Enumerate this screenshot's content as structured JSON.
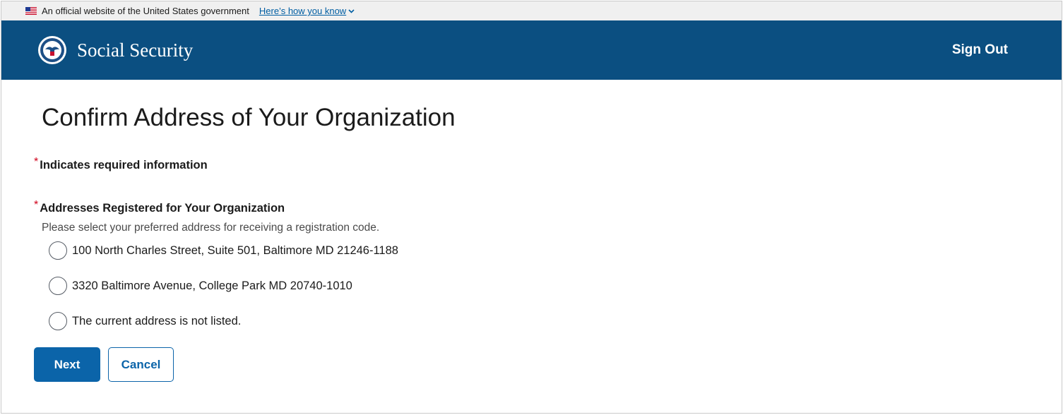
{
  "gov_banner": {
    "text": "An official website of the United States government",
    "link_label": "Here’s how you know"
  },
  "header": {
    "brand": "Social Security",
    "sign_out": "Sign Out"
  },
  "page": {
    "title": "Confirm Address of Your Organization",
    "required_marker": "*",
    "required_note": "Indicates required information"
  },
  "address_field": {
    "legend": "Addresses Registered for Your Organization",
    "hint": "Please select your preferred address for receiving a registration code.",
    "options": [
      {
        "label": "100 North Charles Street, Suite 501, Baltimore MD 21246-1188",
        "selected": false
      },
      {
        "label": "3320 Baltimore Avenue, College Park MD 20740-1010",
        "selected": false
      },
      {
        "label": "The current address is not listed.",
        "selected": false
      }
    ]
  },
  "actions": {
    "next": "Next",
    "cancel": "Cancel"
  },
  "colors": {
    "header_bg": "#0b4f81",
    "primary": "#0b64a9",
    "required": "#d0021b",
    "link": "#005ea2"
  },
  "icons": [
    "us-flag-icon",
    "chevron-down-icon",
    "ssa-seal-icon"
  ]
}
